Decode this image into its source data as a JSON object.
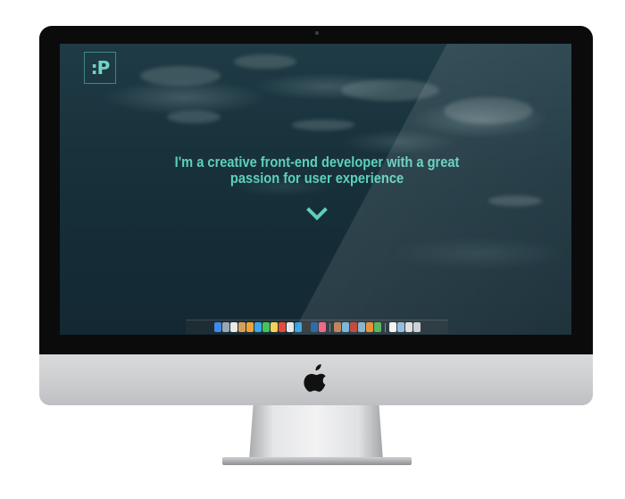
{
  "hero": {
    "logo_text": ":P",
    "headline": "I'm a creative front-end developer with a great passion for user experience",
    "scroll_icon": "chevron-down-icon",
    "accent_color": "#5fcfbd"
  },
  "device": {
    "brand_icon": "apple-logo-icon",
    "frame_color": "#0b0b0c",
    "chin_color": "#cfd0d2"
  },
  "dock": {
    "icons": [
      {
        "name": "finder-icon",
        "color": "#3d8be8"
      },
      {
        "name": "launchpad-icon",
        "color": "#9aa7b3"
      },
      {
        "name": "calendar-icon",
        "color": "#e9e9e9"
      },
      {
        "name": "contacts-icon",
        "color": "#d6a05a"
      },
      {
        "name": "photos-icon",
        "color": "#f0a23a"
      },
      {
        "name": "safari-icon",
        "color": "#3aa6e8"
      },
      {
        "name": "messages-icon",
        "color": "#42c35b"
      },
      {
        "name": "notes-icon",
        "color": "#f2d15a"
      },
      {
        "name": "chrome-icon",
        "color": "#e84a3a"
      },
      {
        "name": "document-icon",
        "color": "#e8e8e8"
      },
      {
        "name": "app-store-icon",
        "color": "#2f9be0"
      },
      {
        "name": "terminal-icon",
        "color": "#2c2c2c"
      },
      {
        "name": "photoshop-icon",
        "color": "#1c5a9e"
      },
      {
        "name": "music-icon",
        "color": "#f05a7a"
      },
      {
        "name": "separator",
        "color": ""
      },
      {
        "name": "tool-icon",
        "color": "#b97a4a"
      },
      {
        "name": "preview-icon",
        "color": "#6ab1d8"
      },
      {
        "name": "photo-booth-icon",
        "color": "#c0392b"
      },
      {
        "name": "iphoto-icon",
        "color": "#7ab0c9"
      },
      {
        "name": "firefox-icon",
        "color": "#e9852a"
      },
      {
        "name": "chrome-2-icon",
        "color": "#4caf50"
      },
      {
        "name": "separator",
        "color": ""
      },
      {
        "name": "file-icon",
        "color": "#f2f2f2"
      },
      {
        "name": "folder-icon",
        "color": "#8fb7d9"
      },
      {
        "name": "file-2-icon",
        "color": "#dcdcdc"
      },
      {
        "name": "trash-icon",
        "color": "#c9cdd2"
      }
    ]
  }
}
